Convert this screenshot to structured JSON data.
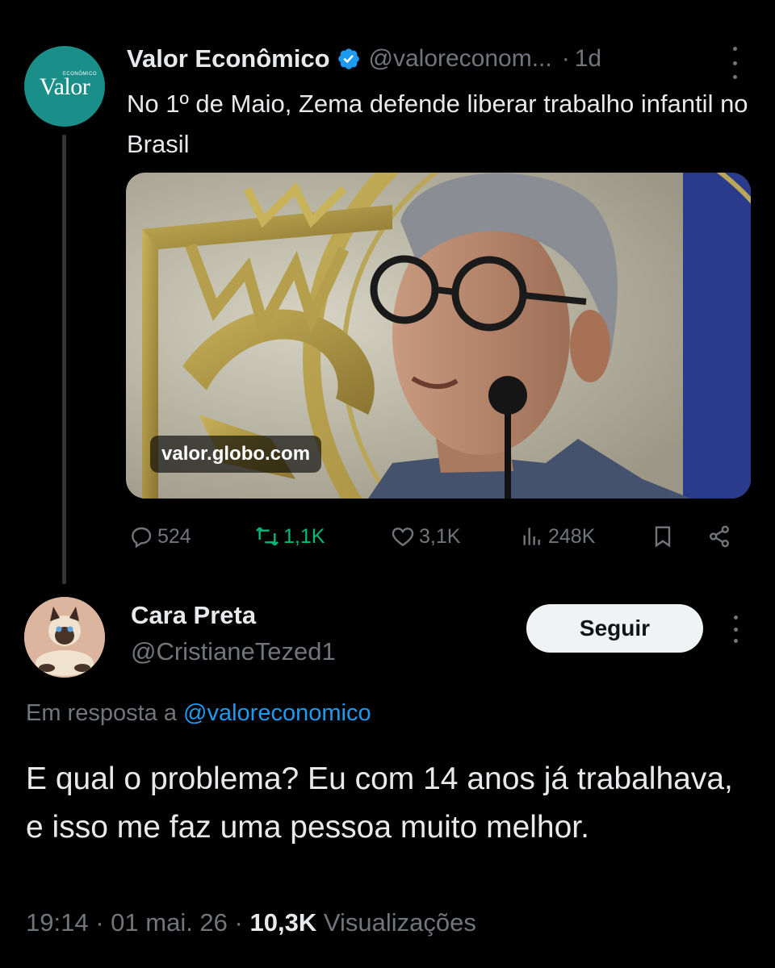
{
  "parent_tweet": {
    "avatar_logo": "Valor",
    "avatar_logo_small": "ECONÔMICO",
    "author_name": "Valor Econômico",
    "handle": "@valoreconom...",
    "separator": "·",
    "time": "1d",
    "text": "No 1º de Maio, Zema defende liberar trabalho infantil no Brasil",
    "media_domain": "valor.globo.com",
    "actions": {
      "replies": "524",
      "retweets": "1,1K",
      "likes": "3,1K",
      "views": "248K"
    }
  },
  "reply_tweet": {
    "author_name": "Cara Preta",
    "handle": "@CristianeTezed1",
    "follow_label": "Seguir",
    "in_reply_prefix": "Em resposta a ",
    "in_reply_mention": "@valoreconomico",
    "text": "E qual o problema? Eu com 14 anos já trabalhava, e isso me faz uma pessoa muito melhor.",
    "time": "19:14",
    "separator": "·",
    "date": "01 mai. 26",
    "views_count": "10,3K",
    "views_label": "Visualizações"
  },
  "colors": {
    "background": "#000000",
    "text_primary": "#e7e9ea",
    "text_secondary": "#71767b",
    "accent_blue": "#1d9bf0",
    "retweet_green": "#00ba7c",
    "valor_teal": "#1a8f8a"
  },
  "icons": {
    "verified": "verified-badge-icon",
    "reply": "reply-icon",
    "retweet": "retweet-icon",
    "like": "heart-icon",
    "views": "views-icon",
    "bookmark": "bookmark-icon",
    "share": "share-icon",
    "more": "more-vertical-icon"
  }
}
